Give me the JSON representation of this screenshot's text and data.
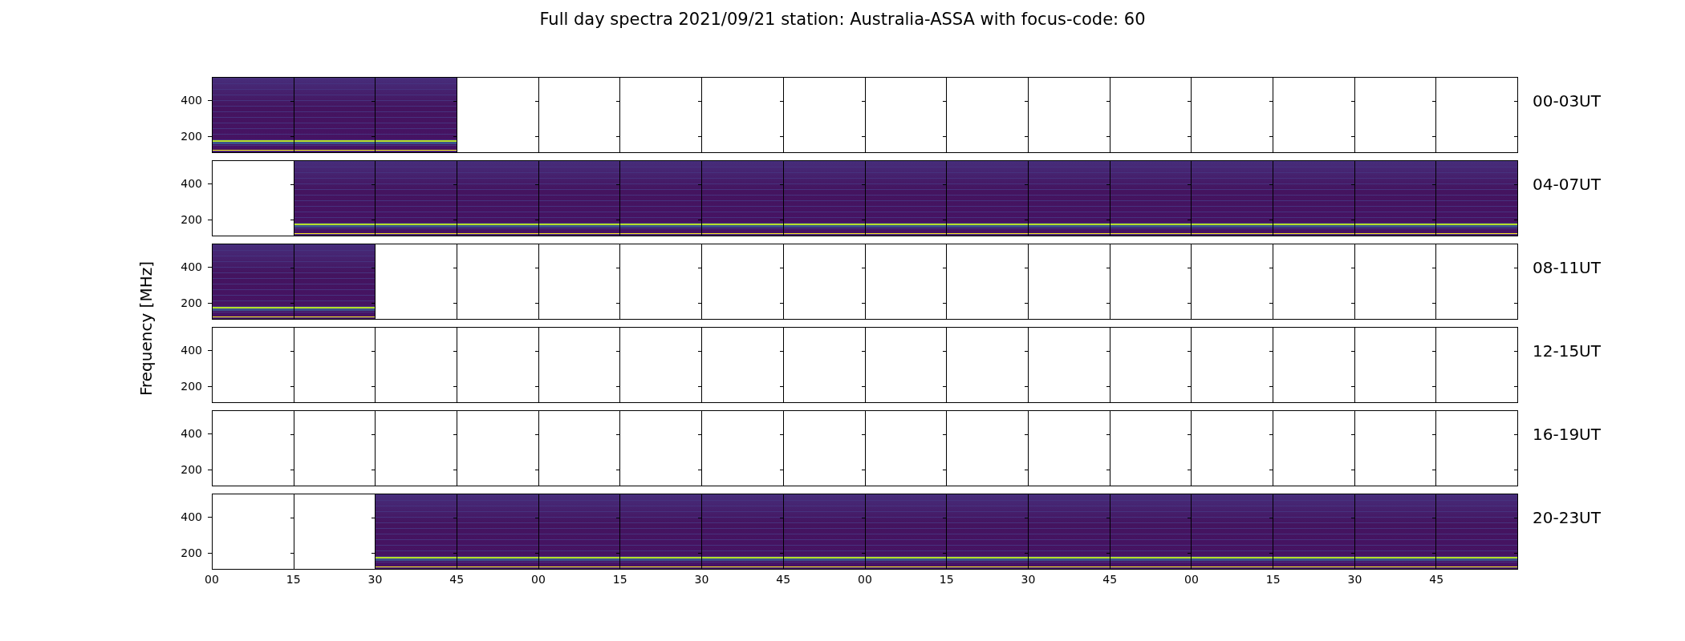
{
  "title": "Full day spectra 2021/09/21 station: Australia-ASSA with focus-code: 60",
  "ylabel": "Frequency [MHz]",
  "rows": [
    {
      "label": "00-03UT",
      "yticks": [
        "400",
        "200"
      ],
      "panels": [
        {
          "filled": true
        },
        {
          "filled": true
        },
        {
          "filled": true
        },
        {
          "filled": false
        },
        {
          "filled": false
        },
        {
          "filled": false
        },
        {
          "filled": false
        },
        {
          "filled": false
        },
        {
          "filled": false
        },
        {
          "filled": false
        },
        {
          "filled": false
        },
        {
          "filled": false
        },
        {
          "filled": false
        },
        {
          "filled": false
        },
        {
          "filled": false
        },
        {
          "filled": false
        }
      ]
    },
    {
      "label": "04-07UT",
      "yticks": [
        "400",
        "200"
      ],
      "panels": [
        {
          "filled": false
        },
        {
          "filled": true
        },
        {
          "filled": true
        },
        {
          "filled": true
        },
        {
          "filled": true
        },
        {
          "filled": true
        },
        {
          "filled": true
        },
        {
          "filled": true
        },
        {
          "filled": true
        },
        {
          "filled": true
        },
        {
          "filled": true
        },
        {
          "filled": true
        },
        {
          "filled": true
        },
        {
          "filled": true
        },
        {
          "filled": true
        },
        {
          "filled": true
        }
      ]
    },
    {
      "label": "08-11UT",
      "yticks": [
        "400",
        "200"
      ],
      "panels": [
        {
          "filled": true
        },
        {
          "filled": true
        },
        {
          "filled": false
        },
        {
          "filled": false
        },
        {
          "filled": false
        },
        {
          "filled": false
        },
        {
          "filled": false
        },
        {
          "filled": false
        },
        {
          "filled": false
        },
        {
          "filled": false
        },
        {
          "filled": false
        },
        {
          "filled": false
        },
        {
          "filled": false
        },
        {
          "filled": false
        },
        {
          "filled": false
        },
        {
          "filled": false
        }
      ]
    },
    {
      "label": "12-15UT",
      "yticks": [
        "400",
        "200"
      ],
      "panels": [
        {
          "filled": false
        },
        {
          "filled": false
        },
        {
          "filled": false
        },
        {
          "filled": false
        },
        {
          "filled": false
        },
        {
          "filled": false
        },
        {
          "filled": false
        },
        {
          "filled": false
        },
        {
          "filled": false
        },
        {
          "filled": false
        },
        {
          "filled": false
        },
        {
          "filled": false
        },
        {
          "filled": false
        },
        {
          "filled": false
        },
        {
          "filled": false
        },
        {
          "filled": false
        }
      ]
    },
    {
      "label": "16-19UT",
      "yticks": [
        "400",
        "200"
      ],
      "panels": [
        {
          "filled": false
        },
        {
          "filled": false
        },
        {
          "filled": false
        },
        {
          "filled": false
        },
        {
          "filled": false
        },
        {
          "filled": false
        },
        {
          "filled": false
        },
        {
          "filled": false
        },
        {
          "filled": false
        },
        {
          "filled": false
        },
        {
          "filled": false
        },
        {
          "filled": false
        },
        {
          "filled": false
        },
        {
          "filled": false
        },
        {
          "filled": false
        },
        {
          "filled": false
        }
      ]
    },
    {
      "label": "20-23UT",
      "yticks": [
        "400",
        "200"
      ],
      "panels": [
        {
          "filled": false
        },
        {
          "filled": false
        },
        {
          "filled": true
        },
        {
          "filled": true
        },
        {
          "filled": true
        },
        {
          "filled": true
        },
        {
          "filled": true
        },
        {
          "filled": true
        },
        {
          "filled": true
        },
        {
          "filled": true
        },
        {
          "filled": true
        },
        {
          "filled": true
        },
        {
          "filled": true
        },
        {
          "filled": true
        },
        {
          "filled": true
        },
        {
          "filled": true
        }
      ]
    }
  ],
  "xticks": [
    "00",
    "15",
    "30",
    "45",
    "00",
    "15",
    "30",
    "45",
    "00",
    "15",
    "30",
    "45",
    "00",
    "15",
    "30",
    "45"
  ]
}
